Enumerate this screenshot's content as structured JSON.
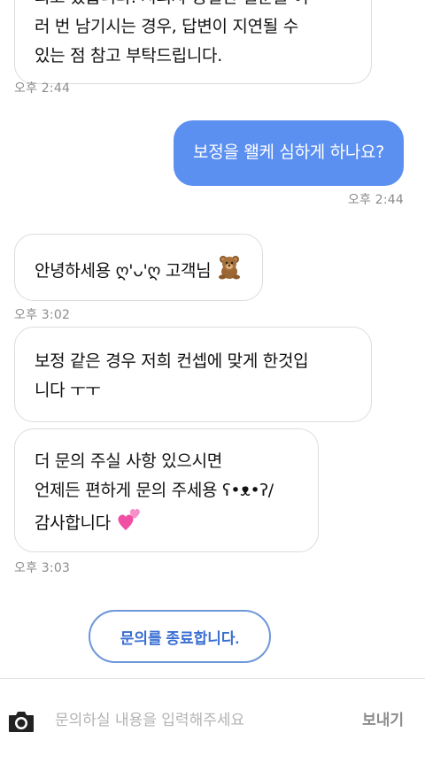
{
  "messages": [
    {
      "from": "agent",
      "lines": [
        "되고 있습니다. 시의사 동일한 질문을 여",
        "러 번 남기시는 경우, 답변이 지연될 수",
        "있는 점 참고 부탁드립니다."
      ]
    },
    {
      "from": "agent_time",
      "time": "오후 2:44"
    },
    {
      "from": "user",
      "lines": [
        "보정을 왤케 심하게 하나요?"
      ]
    },
    {
      "from": "user_time",
      "time": "오후 2:44"
    },
    {
      "from": "agent",
      "lines": [
        "안녕하세용 ღ'ᴗ'ღ 고객님"
      ],
      "emoji": "teddy-bear"
    },
    {
      "from": "agent_time",
      "time": "오후 3:02"
    },
    {
      "from": "agent",
      "lines": [
        "보정 같은 경우 저희 컨셉에 맞게 한것입",
        "니다 ㅜㅜ"
      ]
    },
    {
      "from": "agent",
      "lines": [
        "더 문의 주실 사항 있으시면",
        "언제든 편하게 문의 주세용 ʕ•ᴥ•ʔ/",
        "감사합니다"
      ],
      "emoji": "two-hearts"
    },
    {
      "from": "agent_time",
      "time": "오후 3:03"
    }
  ],
  "end_chat_button": "문의를 종료합니다.",
  "composer": {
    "placeholder": "문의하실 내용을 입력해주세요",
    "send_label": "보내기",
    "camera_icon": "camera-icon"
  },
  "colors": {
    "user_bubble": "#5b8ff0",
    "agent_border": "#dcdcdc",
    "end_button": "#3a6fd2"
  }
}
